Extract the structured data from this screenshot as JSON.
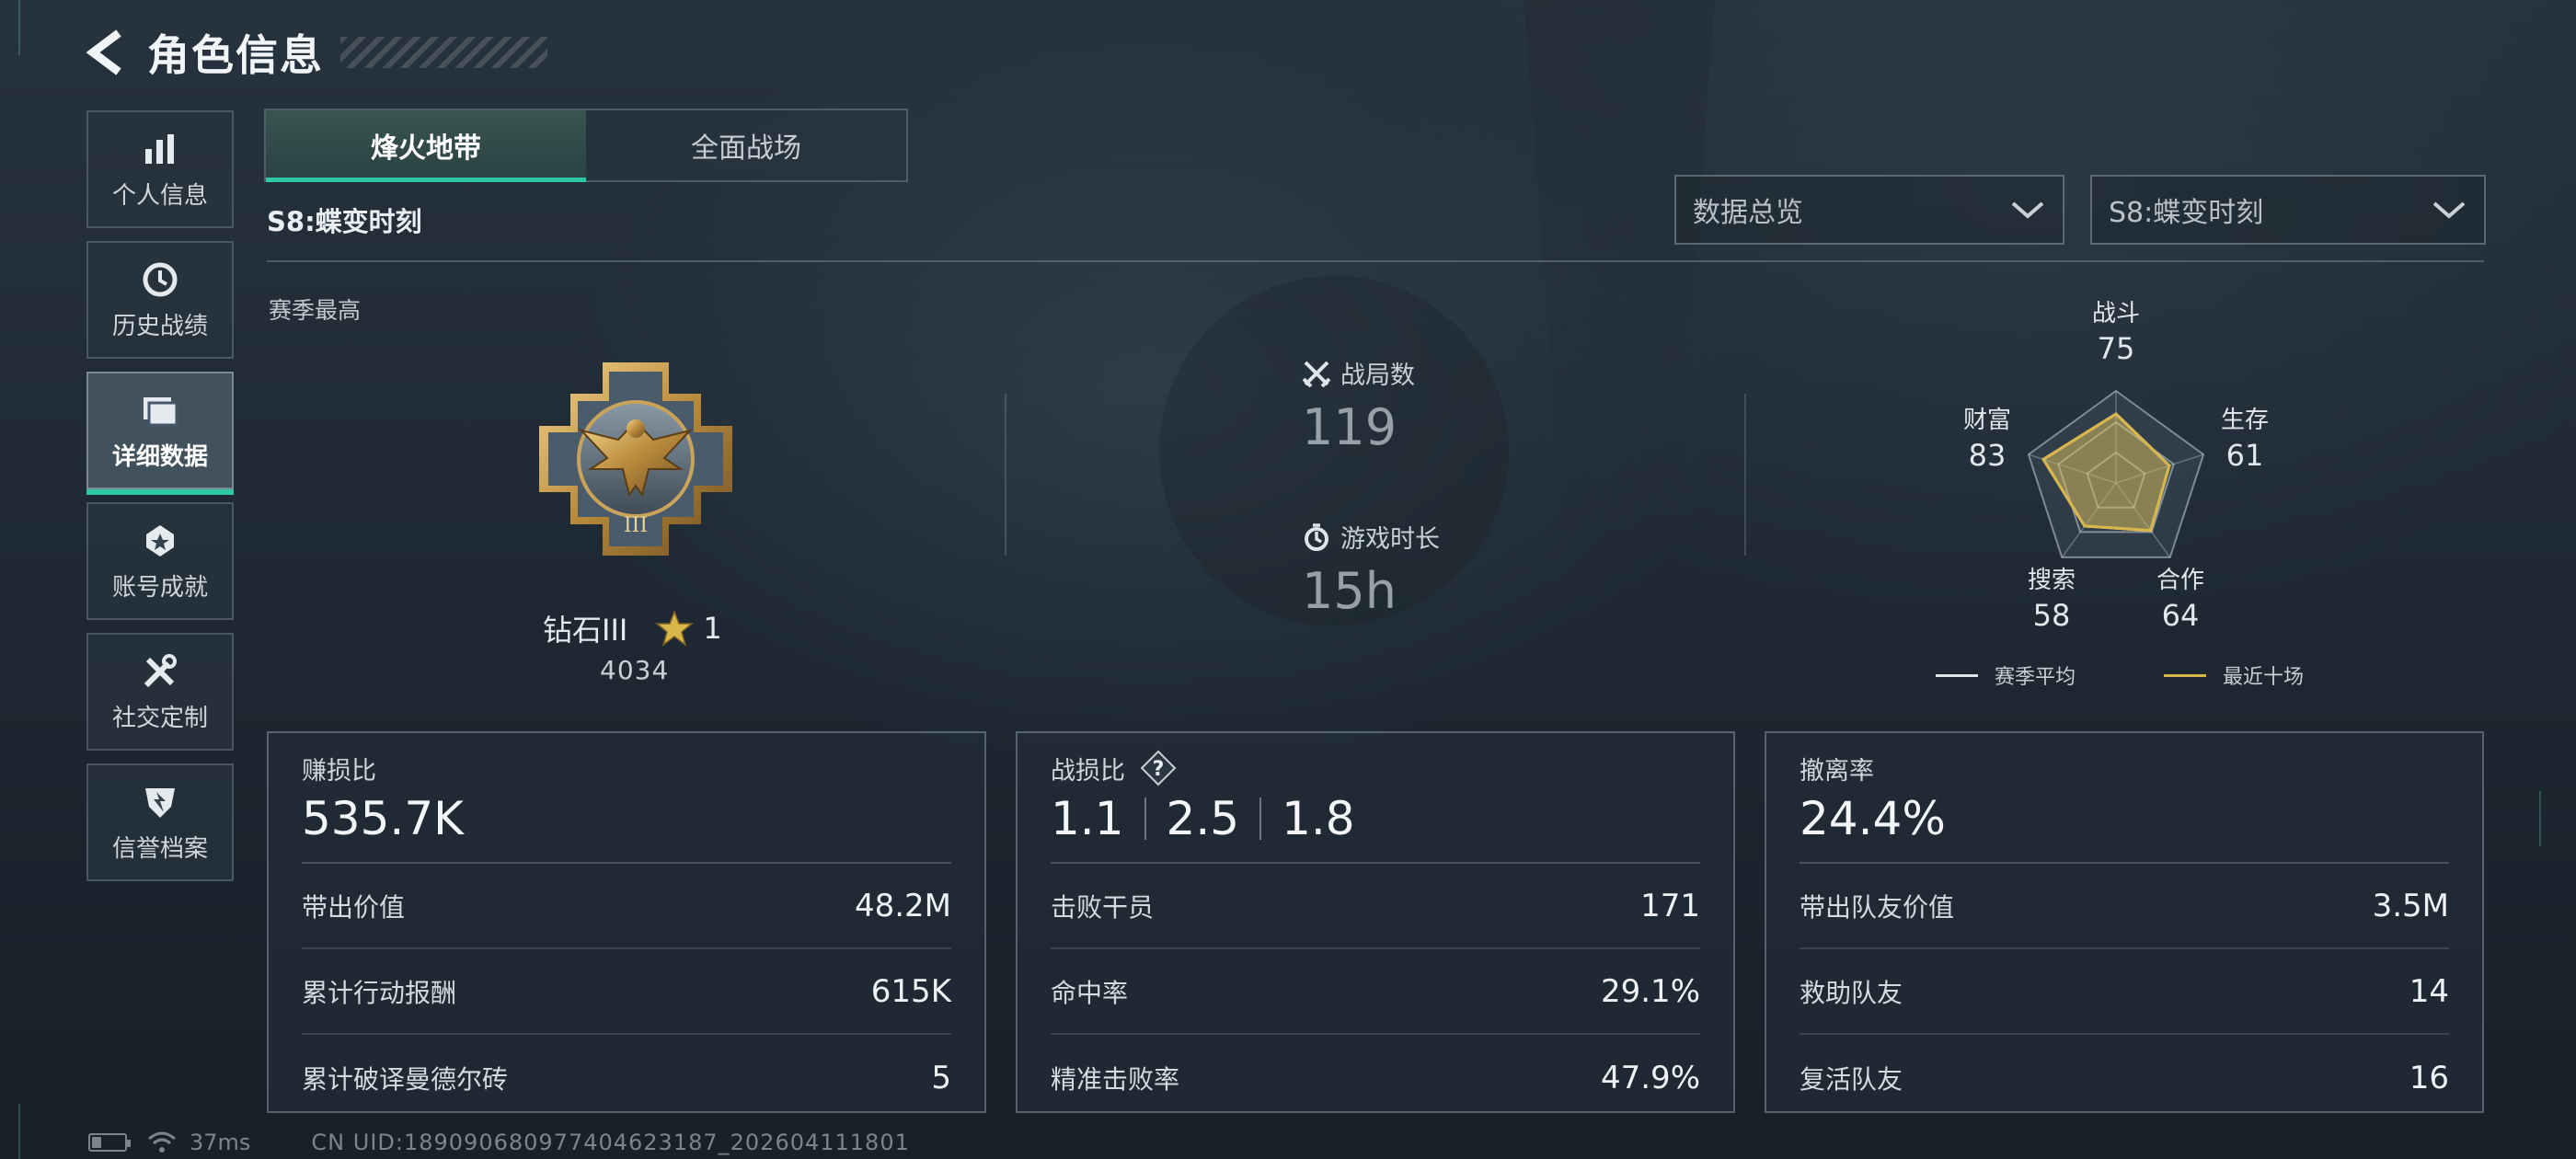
{
  "header": {
    "title": "角色信息"
  },
  "sidebar": {
    "items": [
      {
        "label": "个人信息",
        "icon": "bar-chart-icon"
      },
      {
        "label": "历史战绩",
        "icon": "history-clock-icon"
      },
      {
        "label": "详细数据",
        "icon": "folder-icon",
        "active": true
      },
      {
        "label": "账号成就",
        "icon": "achievement-icon"
      },
      {
        "label": "社交定制",
        "icon": "wrench-tools-icon"
      },
      {
        "label": "信誉档案",
        "icon": "credibility-shield-icon"
      }
    ]
  },
  "tabs": [
    {
      "label": "烽火地带",
      "active": true
    },
    {
      "label": "全面战场",
      "active": false
    }
  ],
  "season_label": "S8:蝶变时刻",
  "filters": {
    "view": "数据总览",
    "season": "S8:蝶变时刻"
  },
  "overview": {
    "season_best_label": "赛季最高",
    "rank_name": "钻石III",
    "rank_stars": "1",
    "rank_score": "4034",
    "matches_label": "战局数",
    "matches_value": "119",
    "playtime_label": "游戏时长",
    "playtime_value": "15h"
  },
  "radar": {
    "axes": [
      {
        "label": "战斗",
        "value": "75",
        "recent": 75
      },
      {
        "label": "生存",
        "value": "61",
        "recent": 61
      },
      {
        "label": "合作",
        "value": "64",
        "recent": 64
      },
      {
        "label": "搜索",
        "value": "58",
        "recent": 58
      },
      {
        "label": "财富",
        "value": "83",
        "recent": 83
      }
    ],
    "legend_avg": "赛季平均",
    "legend_recent": "最近十场",
    "colors": {
      "avg": "#dfe4e8",
      "recent": "#d8b64a"
    }
  },
  "cards": {
    "profit": {
      "title": "赚损比",
      "big": "535.7K",
      "rows": [
        {
          "k": "带出价值",
          "v": "48.2M"
        },
        {
          "k": "累计行动报酬",
          "v": "615K"
        },
        {
          "k": "累计破译曼德尔砖",
          "v": "5"
        }
      ]
    },
    "kd": {
      "title": "战损比",
      "help": "?",
      "values": [
        "1.1",
        "2.5",
        "1.8"
      ],
      "rows": [
        {
          "k": "击败干员",
          "v": "171"
        },
        {
          "k": "命中率",
          "v": "29.1%"
        },
        {
          "k": "精准击败率",
          "v": "47.9%"
        }
      ]
    },
    "extract": {
      "title": "撤离率",
      "big": "24.4%",
      "rows": [
        {
          "k": "带出队友价值",
          "v": "3.5M"
        },
        {
          "k": "救助队友",
          "v": "14"
        },
        {
          "k": "复活队友",
          "v": "16"
        }
      ]
    }
  },
  "footer": {
    "ping": "37ms",
    "uid": "CN UID:1890906809774046231​87_202604111801"
  },
  "colors": {
    "accent": "#2ec9a2",
    "gold": "#d8b64a"
  }
}
